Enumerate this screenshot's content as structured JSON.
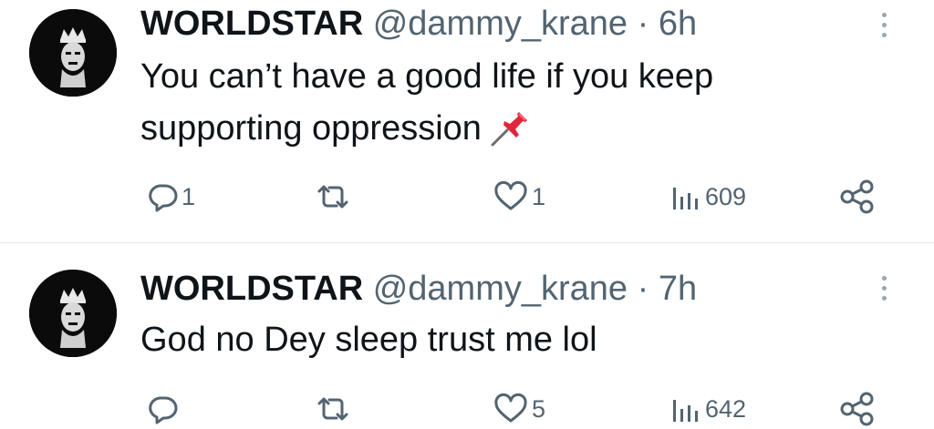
{
  "tweets": [
    {
      "name": "WORLDSTAR",
      "handle": "@dammy_krane",
      "separator": "·",
      "time": "6h",
      "text": "You can’t have a good life if you keep supporting oppression",
      "emoji": "pushpin-icon",
      "replies": "1",
      "retweets": "",
      "likes": "1",
      "views": "609"
    },
    {
      "name": "WORLDSTAR",
      "handle": "@dammy_krane",
      "separator": "·",
      "time": "7h",
      "text": "God no Dey sleep trust me lol",
      "replies": "",
      "retweets": "",
      "likes": "5",
      "views": "642"
    }
  ],
  "colors": {
    "text": "#0f1419",
    "secondary": "#536471",
    "divider": "#e6e9eb",
    "pin": "#e0263a"
  }
}
